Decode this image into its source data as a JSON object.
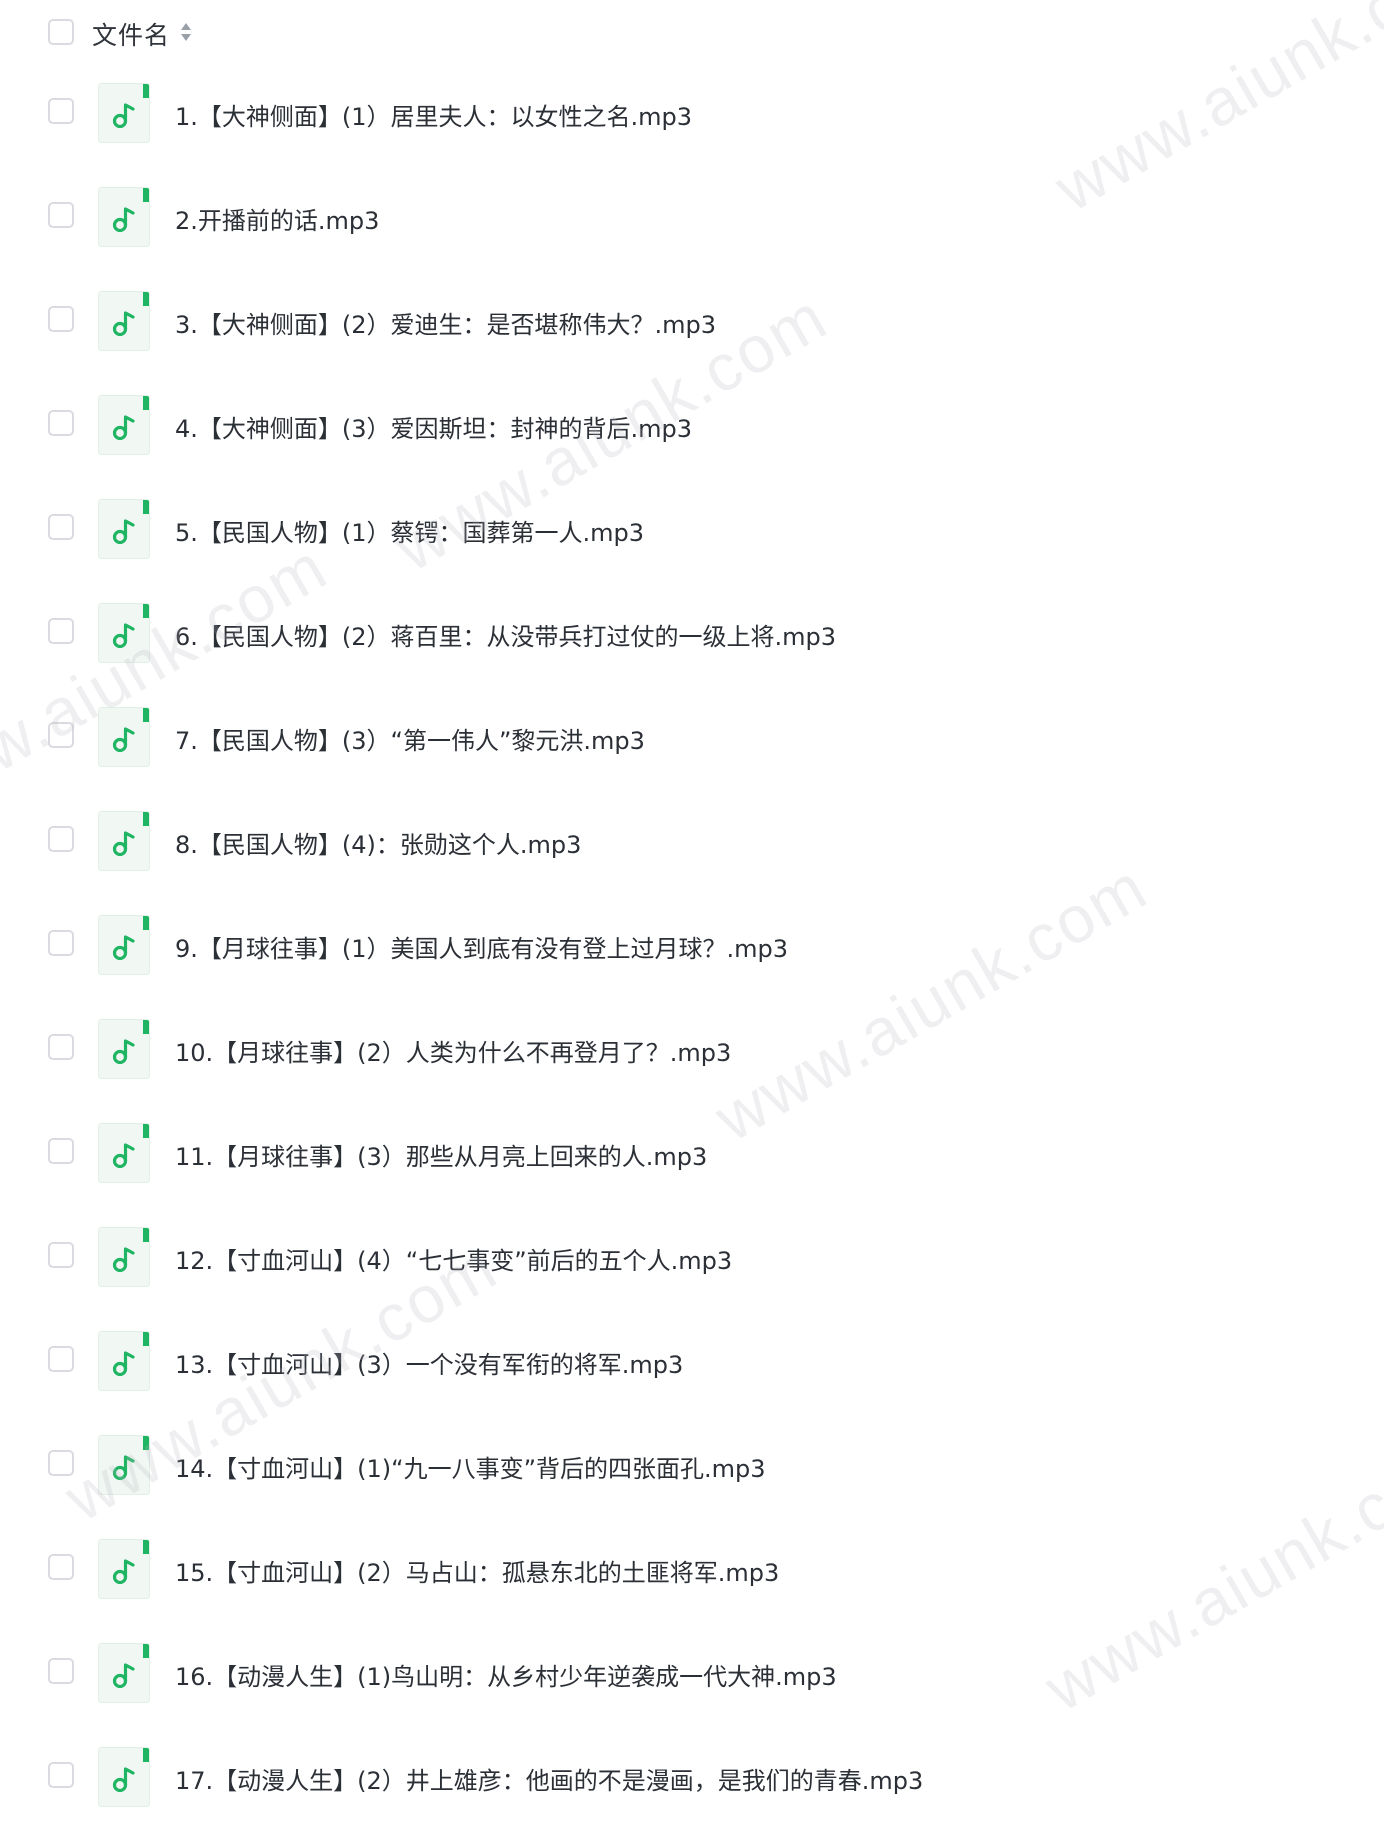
{
  "header": {
    "column_label": "文件名",
    "sort_icon": "sort-icon"
  },
  "file_icon": "music-note-icon",
  "accent_color": "#1fb563",
  "files": [
    {
      "name": "1.【大神侧面】(1）居里夫人：以女性之名.mp3"
    },
    {
      "name": "2.开播前的话.mp3"
    },
    {
      "name": "3.【大神侧面】(2）爱迪生：是否堪称伟大？.mp3"
    },
    {
      "name": "4.【大神侧面】(3）爱因斯坦：封神的背后.mp3"
    },
    {
      "name": "5.【民国人物】(1）蔡锷：国葬第一人.mp3"
    },
    {
      "name": "6.【民国人物】(2）蒋百里：从没带兵打过仗的一级上将.mp3"
    },
    {
      "name": "7.【民国人物】(3）“第一伟人”黎元洪.mp3"
    },
    {
      "name": "8.【民国人物】(4)：张勋这个人.mp3"
    },
    {
      "name": "9.【月球往事】(1）美国人到底有没有登上过月球？.mp3"
    },
    {
      "name": "10.【月球往事】(2）人类为什么不再登月了？.mp3"
    },
    {
      "name": "11.【月球往事】(3）那些从月亮上回来的人.mp3"
    },
    {
      "name": "12.【寸血河山】(4）“七七事变”前后的五个人.mp3"
    },
    {
      "name": "13.【寸血河山】(3）一个没有军衔的将军.mp3"
    },
    {
      "name": "14.【寸血河山】(1)“九一八事变”背后的四张面孔.mp3"
    },
    {
      "name": "15.【寸血河山】(2）马占山：孤悬东北的土匪将军.mp3"
    },
    {
      "name": "16.【动漫人生】(1)鸟山明：从乡村少年逆袭成一代大神.mp3"
    },
    {
      "name": "17.【动漫人生】(2）井上雄彦：他画的不是漫画，是我们的青春.mp3"
    }
  ],
  "watermark_text": "www.aiunk.com"
}
